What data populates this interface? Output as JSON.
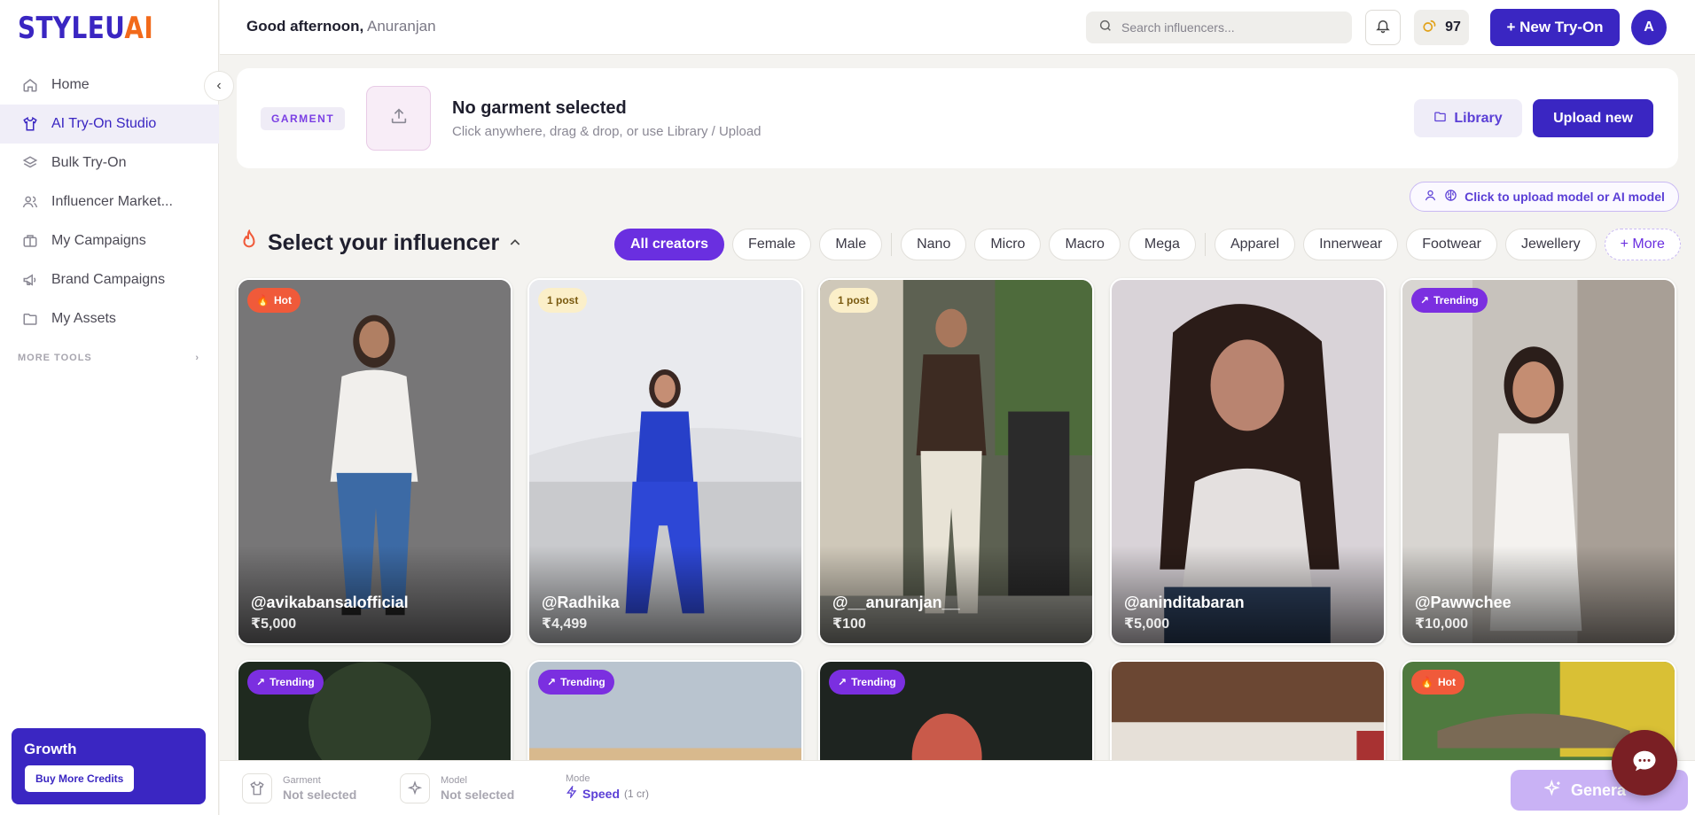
{
  "brand": {
    "logo_part1": "STYLEU",
    "logo_part2": "AI"
  },
  "sidebar": {
    "items": [
      {
        "label": "Home",
        "icon": "home-icon"
      },
      {
        "label": "AI Try-On Studio",
        "icon": "shirt-icon",
        "active": true
      },
      {
        "label": "Bulk Try-On",
        "icon": "layers-icon"
      },
      {
        "label": "Influencer Market...",
        "icon": "users-icon"
      },
      {
        "label": "My Campaigns",
        "icon": "briefcase-icon"
      },
      {
        "label": "Brand Campaigns",
        "icon": "megaphone-icon"
      },
      {
        "label": "My Assets",
        "icon": "folder-icon"
      }
    ],
    "more_tools": "MORE TOOLS",
    "growth": {
      "title": "Growth",
      "button": "Buy More Credits"
    }
  },
  "header": {
    "greeting": "Good afternoon,",
    "name": "Anuranjan",
    "search_placeholder": "Search influencers...",
    "credits": "97",
    "new_tryon": "+ New Try-On",
    "avatar_initial": "A"
  },
  "garment": {
    "badge": "GARMENT",
    "title": "No garment selected",
    "subtitle": "Click anywhere, drag & drop, or use Library / Upload",
    "library": "Library",
    "upload": "Upload new"
  },
  "model_upload": "Click to upload model or AI model",
  "selector": {
    "title": "Select your influencer",
    "chips": [
      "All creators",
      "Female",
      "Male",
      "Nano",
      "Micro",
      "Macro",
      "Mega",
      "Apparel",
      "Innerwear",
      "Footwear",
      "Jewellery"
    ],
    "more": "+ More"
  },
  "cards": [
    {
      "handle": "@avikabansalofficial",
      "price": "₹5,000",
      "badge": "Hot",
      "badge_type": "hot"
    },
    {
      "handle": "@Radhika",
      "price": "₹4,499",
      "badge": "1 post",
      "badge_type": "post"
    },
    {
      "handle": "@__anuranjan__",
      "price": "₹100",
      "badge": "1 post",
      "badge_type": "post"
    },
    {
      "handle": "@aninditabaran",
      "price": "₹5,000",
      "badge": "",
      "badge_type": ""
    },
    {
      "handle": "@Pawwchee",
      "price": "₹10,000",
      "badge": "Trending",
      "badge_type": "trend"
    }
  ],
  "cards_row2": [
    {
      "badge": "Trending",
      "badge_type": "trend"
    },
    {
      "badge": "Trending",
      "badge_type": "trend"
    },
    {
      "badge": "Trending",
      "badge_type": "trend"
    },
    {
      "badge": "",
      "badge_type": ""
    },
    {
      "badge": "Hot",
      "badge_type": "hot"
    }
  ],
  "bottombar": {
    "garment_label": "Garment",
    "garment_value": "Not selected",
    "model_label": "Model",
    "model_value": "Not selected",
    "mode_label": "Mode",
    "mode_value": "Speed",
    "mode_cost": "(1 cr)",
    "generate": "Genera"
  },
  "colors": {
    "primary": "#3a26c2",
    "accent": "#6a2fe0",
    "hot": "#f05a3a",
    "orange_logo": "#f26a1b"
  }
}
